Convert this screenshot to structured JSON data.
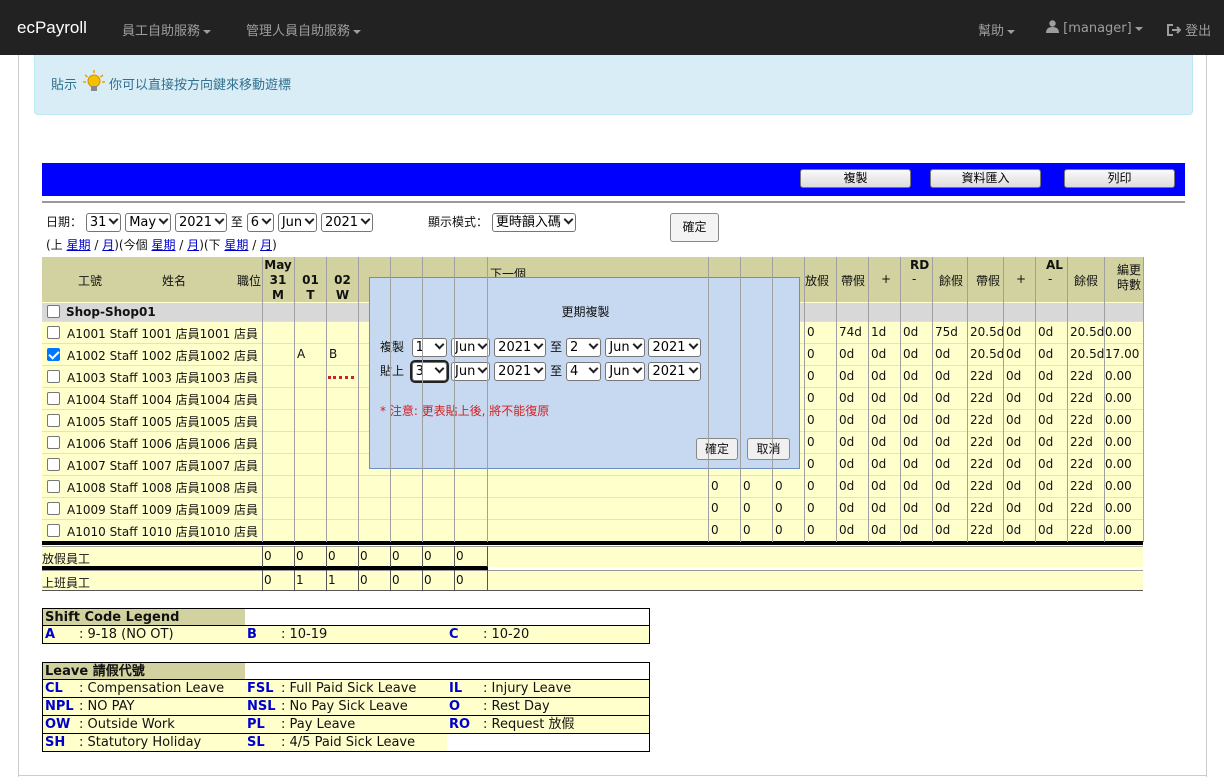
{
  "nav": {
    "brand": "ecPayroll",
    "employee_menu": "員工自助服務",
    "manager_menu": "管理人員自助服務",
    "help": "幫助",
    "user": "[manager]",
    "logout": "登出"
  },
  "tip": {
    "label": "貼示",
    "text": "你可以直接按方向鍵來移動遊標"
  },
  "toolbar": {
    "copy": "複製",
    "import": "資料匯入",
    "print": "列印"
  },
  "filter": {
    "date_label": "日期：",
    "from_day": "31",
    "from_month": "May",
    "from_year": "2021",
    "to_label": "至",
    "to_day": "6",
    "to_month": "Jun",
    "to_year": "2021",
    "mode_label": "顯示模式：",
    "mode_value": "更時韻入碼",
    "ok": "確定",
    "nav_prefix": "(上",
    "week": "星期",
    "slash": "/",
    "month": "月",
    "mid": ")(今個",
    "next": ")(下",
    "end": ")"
  },
  "table": {
    "headers": {
      "id": "工號",
      "name": "姓名",
      "position": "職位",
      "may": "May",
      "d31": "31",
      "w31": "M",
      "d01": "01",
      "w01": "T",
      "d02": "02",
      "w02": "W",
      "next_period": "下一個",
      "leave": "放假",
      "rd": "RD",
      "al": "AL",
      "carry": "帶假",
      "plus": "+",
      "minus": "-",
      "balance": "餘假",
      "shift_hours": "編更時數"
    },
    "shop": "Shop-Shop01",
    "rows": [
      {
        "text": "A1001 Staff 1001 店員1001 店員",
        "d31": "",
        "d01": "",
        "d02": "",
        "n": [
          "",
          "",
          "",
          ""
        ],
        "rd": [
          "74d",
          "1d",
          "0d",
          "75d"
        ],
        "al": [
          "20.5d",
          "0d",
          "0d",
          "20.5d"
        ],
        "hrs": "0.00",
        "checked": false
      },
      {
        "text": "A1002 Staff 1002 店員1002 店員",
        "d31": "",
        "d01": "A",
        "d02": "B",
        "n": [
          "",
          "",
          "",
          ""
        ],
        "rd": [
          "0d",
          "0d",
          "0d",
          "0d"
        ],
        "al": [
          "20.5d",
          "0d",
          "0d",
          "20.5d"
        ],
        "hrs": "17.00",
        "checked": true
      },
      {
        "text": "A1003 Staff 1003 店員1003 店員",
        "d31": "",
        "d01": "",
        "d02": "",
        "n": [
          "",
          "",
          "",
          ""
        ],
        "rd": [
          "0d",
          "0d",
          "0d",
          "0d"
        ],
        "al": [
          "22d",
          "0d",
          "0d",
          "22d"
        ],
        "hrs": "0.00",
        "checked": false
      },
      {
        "text": "A1004 Staff 1004 店員1004 店員",
        "d31": "",
        "d01": "",
        "d02": "",
        "n": [
          "",
          "",
          "",
          ""
        ],
        "rd": [
          "0d",
          "0d",
          "0d",
          "0d"
        ],
        "al": [
          "22d",
          "0d",
          "0d",
          "22d"
        ],
        "hrs": "0.00",
        "checked": false
      },
      {
        "text": "A1005 Staff 1005 店員1005 店員",
        "d31": "",
        "d01": "",
        "d02": "",
        "n": [
          "",
          "",
          "",
          ""
        ],
        "rd": [
          "0d",
          "0d",
          "0d",
          "0d"
        ],
        "al": [
          "22d",
          "0d",
          "0d",
          "22d"
        ],
        "hrs": "0.00",
        "checked": false
      },
      {
        "text": "A1006 Staff 1006 店員1006 店員",
        "d31": "",
        "d01": "",
        "d02": "",
        "n": [
          "",
          "",
          "",
          ""
        ],
        "rd": [
          "0d",
          "0d",
          "0d",
          "0d"
        ],
        "al": [
          "22d",
          "0d",
          "0d",
          "22d"
        ],
        "hrs": "0.00",
        "checked": false
      },
      {
        "text": "A1007 Staff 1007 店員1007 店員",
        "d31": "",
        "d01": "",
        "d02": "",
        "n": [
          "",
          "",
          "",
          ""
        ],
        "rd": [
          "0d",
          "0d",
          "0d",
          "0d"
        ],
        "al": [
          "22d",
          "0d",
          "0d",
          "22d"
        ],
        "hrs": "0.00",
        "checked": false
      },
      {
        "text": "A1008 Staff 1008 店員1008 店員",
        "d31": "",
        "d01": "",
        "d02": "",
        "n": [
          "0",
          "0",
          "0",
          "0"
        ],
        "rd": [
          "0d",
          "0d",
          "0d",
          "0d"
        ],
        "al": [
          "22d",
          "0d",
          "0d",
          "22d"
        ],
        "hrs": "0.00",
        "checked": false
      },
      {
        "text": "A1009 Staff 1009 店員1009 店員",
        "d31": "",
        "d01": "",
        "d02": "",
        "n": [
          "0",
          "0",
          "0",
          "0"
        ],
        "rd": [
          "0d",
          "0d",
          "0d",
          "0d"
        ],
        "al": [
          "22d",
          "0d",
          "0d",
          "22d"
        ],
        "hrs": "0.00",
        "checked": false
      },
      {
        "text": "A1010 Staff 1010 店員1010 店員",
        "d31": "",
        "d01": "",
        "d02": "",
        "n": [
          "0",
          "0",
          "0",
          "0"
        ],
        "rd": [
          "0d",
          "0d",
          "0d",
          "0d"
        ],
        "al": [
          "22d",
          "0d",
          "0d",
          "22d"
        ],
        "hrs": "0.00",
        "checked": false
      }
    ],
    "n_col_last_rows_1_7": "0",
    "summary": {
      "off_label": "放假員工",
      "off": [
        "0",
        "0",
        "0",
        "0",
        "0",
        "0",
        "0"
      ],
      "on_label": "上班員工",
      "on": [
        "0",
        "1",
        "1",
        "0",
        "0",
        "0",
        "0"
      ]
    }
  },
  "modal": {
    "title": "更期複製",
    "copy_label": "複製",
    "paste_label": "貼上",
    "to": "至",
    "copy_from": {
      "day": "1",
      "month": "Jun",
      "year": "2021"
    },
    "copy_to": {
      "day": "2",
      "month": "Jun",
      "year": "2021"
    },
    "paste_from": {
      "day": "3",
      "month": "Jun",
      "year": "2021"
    },
    "paste_to": {
      "day": "4",
      "month": "Jun",
      "year": "2021"
    },
    "warning": "* 注意: 更表貼上後, 將不能復原",
    "ok": "確定",
    "cancel": "取消"
  },
  "shift_legend": {
    "title": "Shift Code Legend",
    "items": [
      {
        "code": "A",
        "desc": ": 9-18 (NO OT)"
      },
      {
        "code": "B",
        "desc": ": 10-19"
      },
      {
        "code": "C",
        "desc": ": 10-20"
      }
    ]
  },
  "leave_legend": {
    "title": "Leave 請假代號",
    "items": [
      {
        "code": "CL",
        "desc": ": Compensation Leave"
      },
      {
        "code": "FSL",
        "desc": ": Full Paid Sick Leave"
      },
      {
        "code": "IL",
        "desc": ": Injury Leave"
      },
      {
        "code": "NPL",
        "desc": ": NO PAY"
      },
      {
        "code": "NSL",
        "desc": ": No Pay Sick Leave"
      },
      {
        "code": "O",
        "desc": ": Rest Day"
      },
      {
        "code": "OW",
        "desc": ": Outside Work"
      },
      {
        "code": "PL",
        "desc": ": Pay Leave"
      },
      {
        "code": "RO",
        "desc": ": Request 放假"
      },
      {
        "code": "SH",
        "desc": ": Statutory Holiday"
      },
      {
        "code": "SL",
        "desc": ": 4/5 Paid Sick Leave"
      }
    ]
  },
  "colors": {
    "navbar": "#222222",
    "toolbar_blue": "#0000ff",
    "grid_yellow": "#ffffcc",
    "header_olive": "#d2d2a0",
    "modal_blue": "#c6d9f1",
    "warn_red": "#d02020",
    "code_blue": "#0000cc"
  }
}
